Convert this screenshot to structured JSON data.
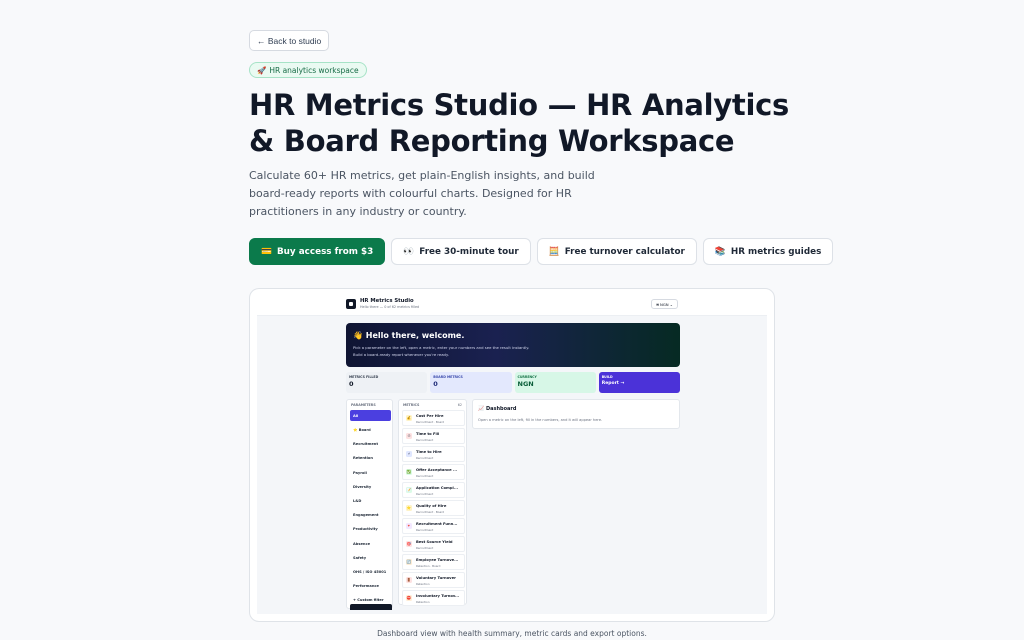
{
  "back_button": {
    "label": "← Back to studio"
  },
  "tag": {
    "icon": "🚀",
    "label": "HR analytics workspace"
  },
  "headline": "HR Metrics Studio — HR Analytics & Board Reporting Workspace",
  "lead": "Calculate 60+ HR metrics, get plain-English insights, and build board-ready reports with colourful charts. Designed for HR practitioners in any industry or country.",
  "ctas": [
    {
      "icon": "💳",
      "label": "Buy access from $3"
    },
    {
      "icon": "👀",
      "label": "Free 30-minute tour"
    },
    {
      "icon": "🧮",
      "label": "Free turnover calculator"
    },
    {
      "icon": "📚",
      "label": "HR metrics guides"
    }
  ],
  "caption": "Dashboard view with health summary, metric cards and export options.",
  "app": {
    "title": "HR Metrics Studio",
    "subtitle": "Hello there — 0 of 62 metrics filled",
    "currency": "₦ NGN ⌄",
    "hero_title": "👋 Hello there, welcome.",
    "hero_line1": "Pick a parameter on the left, open a metric, enter your numbers and see the result instantly.",
    "hero_line2": "Build a board-ready report whenever you're ready.",
    "stats": [
      {
        "key": "METRICS FILLED",
        "value": "0"
      },
      {
        "key": "BOARD METRICS",
        "value": "0"
      },
      {
        "key": "CURRENCY",
        "value": "NGN"
      },
      {
        "key": "BUILD",
        "value": "Report →"
      }
    ],
    "params_heading": "PARAMETERS",
    "params": [
      "All",
      "⭐ Board",
      "Recruitment",
      "Retention",
      "Payroll",
      "Diversity",
      "L&D",
      "Engagement",
      "Productivity",
      "Absence",
      "Safety",
      "OHS / ISO 45001",
      "Performance",
      "+ Custom filter"
    ],
    "metrics_heading": "METRICS",
    "metrics_count": "62",
    "metrics": [
      {
        "icon": "💰",
        "title": "Cost Per Hire",
        "sub": "Recruitment · Board"
      },
      {
        "icon": "⏱",
        "title": "Time to Fill",
        "sub": "Recruitment"
      },
      {
        "icon": "⚡",
        "title": "Time to Hire",
        "sub": "Recruitment"
      },
      {
        "icon": "✅",
        "title": "Offer Acceptance ...",
        "sub": "Recruitment"
      },
      {
        "icon": "📝",
        "title": "Application Compl...",
        "sub": "Recruitment"
      },
      {
        "icon": "⭐",
        "title": "Quality of Hire",
        "sub": "Recruitment · Board"
      },
      {
        "icon": "🔻",
        "title": "Recruitment Funn...",
        "sub": "Recruitment"
      },
      {
        "icon": "🎯",
        "title": "Best Source Yield",
        "sub": "Recruitment"
      },
      {
        "icon": "🔄",
        "title": "Employee Turnove...",
        "sub": "Retention · Board"
      },
      {
        "icon": "🚪",
        "title": "Voluntary Turnover",
        "sub": "Retention"
      },
      {
        "icon": "⛔",
        "title": "Involuntary Turnov...",
        "sub": "Retention"
      }
    ],
    "dashboard_title": "📈 Dashboard",
    "dashboard_desc": "Open a metric on the left, fill in the numbers, and it will appear here."
  }
}
